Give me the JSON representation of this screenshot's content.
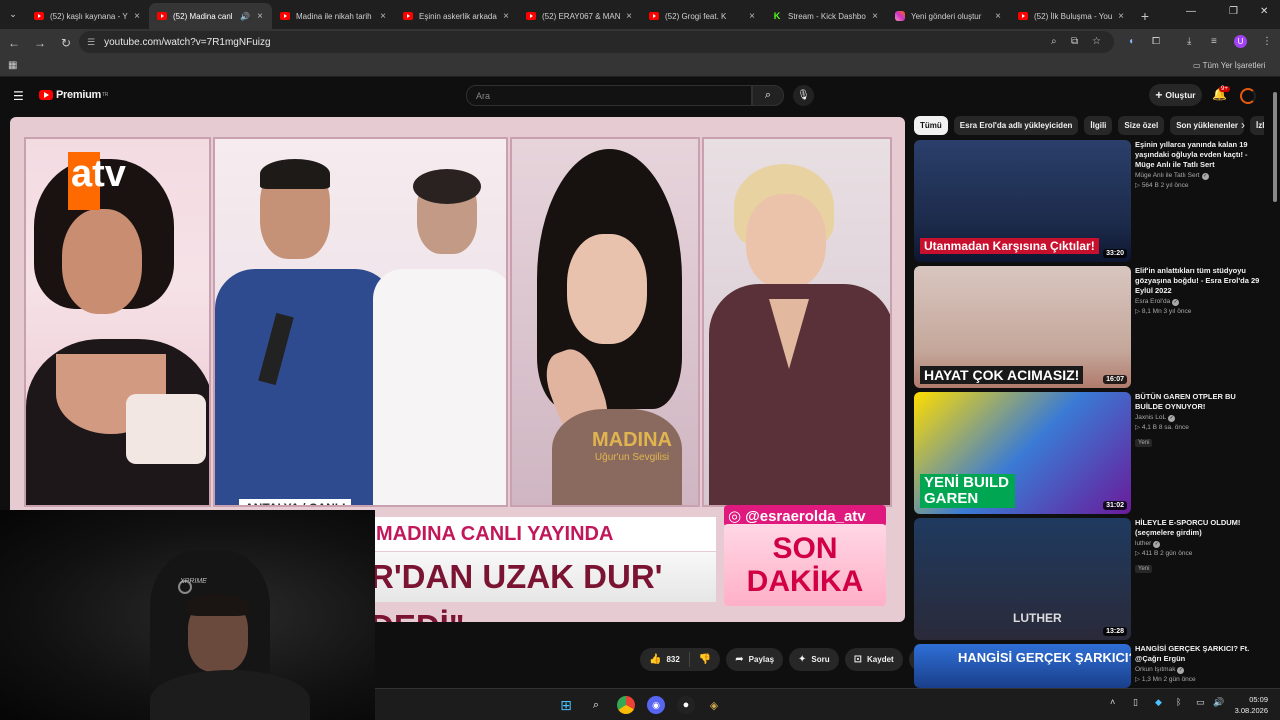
{
  "browser": {
    "tabs": [
      {
        "title": "(52) kaşlı kaynana - Y",
        "kind": "yt"
      },
      {
        "title": "(52) Madina canl",
        "kind": "yt",
        "active": true
      },
      {
        "title": "Madina ile nikah tarih",
        "kind": "yt"
      },
      {
        "title": "Eşinin askerlik arkada",
        "kind": "yt"
      },
      {
        "title": "(52) ERAY067 & MAN",
        "kind": "yt"
      },
      {
        "title": "(52) Grogi feat. K",
        "kind": "yt"
      },
      {
        "title": "Stream - Kick Dashbo",
        "kind": "kick"
      },
      {
        "title": "Yeni gönderi oluştur",
        "kind": "ig"
      },
      {
        "title": "(52) İlk Buluşma - You",
        "kind": "yt"
      }
    ],
    "url": "youtube.com/watch?v=7R1mgNFuizg",
    "bookmarks_folder": "Tüm Yer İşaretleri",
    "profile_initial": "U"
  },
  "youtube": {
    "logo": "Premium",
    "logo_region": "TR",
    "search_placeholder": "Ara",
    "create_label": "Oluştur",
    "notif_count": "9+",
    "actions": {
      "like_count": "832",
      "share": "Paylaş",
      "ask": "Soru",
      "save": "Kaydet"
    },
    "chips": [
      "Tümü",
      "Esra Erol'da adlı yükleyiciden",
      "İlgili",
      "Size özel",
      "Son yüklenenler",
      "İzlen"
    ],
    "recommendations": [
      {
        "title": "Eşinin yıllarca yanında kalan 19 yaşındaki oğluyla evden kaçtı! - Müge Anlı ile Tatlı Sert",
        "channel": "Müge Anlı ile Tatlı Sert",
        "views": "564 B",
        "age": "2 yıl önce",
        "duration": "33:20",
        "thumb_text": "Utanmadan Karşısına Çıktılar!",
        "badge": ""
      },
      {
        "title": "Elif'in anlattıkları tüm stüdyoyu gözyaşına boğdu! - Esra Erol'da 29 Eylül 2022",
        "channel": "Esra Erol'da",
        "views": "8,1 Mn",
        "age": "3 yıl önce",
        "duration": "16:07",
        "thumb_text": "HAYAT ÇOK ACIMASIZ!",
        "badge": ""
      },
      {
        "title": "BÜTÜN GAREN OTPLER BU BUİLDE OYNUYOR!",
        "channel": "Jaxnis LoL",
        "views": "4,1 B",
        "age": "8 sa. önce",
        "duration": "31:02",
        "thumb_text": "YENİ BUILD GAREN",
        "badge": "Yeni"
      },
      {
        "title": "HİLEYLE E-SPORCU OLDUM! (seçmelere girdim)",
        "channel": "luther",
        "views": "411 B",
        "age": "2 gün önce",
        "duration": "13:28",
        "thumb_text": "LUTHER",
        "badge": "Yeni"
      },
      {
        "title": "HANGİSİ GERÇEK ŞARKICI? Ft. @Çağrı Ergün",
        "channel": "Orkun Işıtmak",
        "views": "1,3 Mn",
        "age": "2 gün önce",
        "duration": "",
        "thumb_text": "HANGİSİ GERÇEK ŞARKICI?",
        "badge": ""
      }
    ]
  },
  "video": {
    "caption_name": "MADINA",
    "caption_sub": "Uğur'un Sevgilisi",
    "banner_top": "MADINA CANLI YAYINDA",
    "banner_bottom": "R'DAN UZAK DUR' DEDİ\"",
    "instagram": "@esraerolda_atv",
    "breaking_1": "SON",
    "breaking_2": "DAKİKA",
    "location": "ANTALYA / CANLI",
    "channel_logo": "atv",
    "mic_logo": "atv"
  },
  "webcam": {
    "brand": "XPRIME"
  },
  "taskbar": {
    "time": "05:09",
    "date": "3.08.2026"
  },
  "colors": {
    "yt_red": "#ff0000",
    "accent_pink": "#e0197e",
    "breaking_red": "#d10046"
  }
}
